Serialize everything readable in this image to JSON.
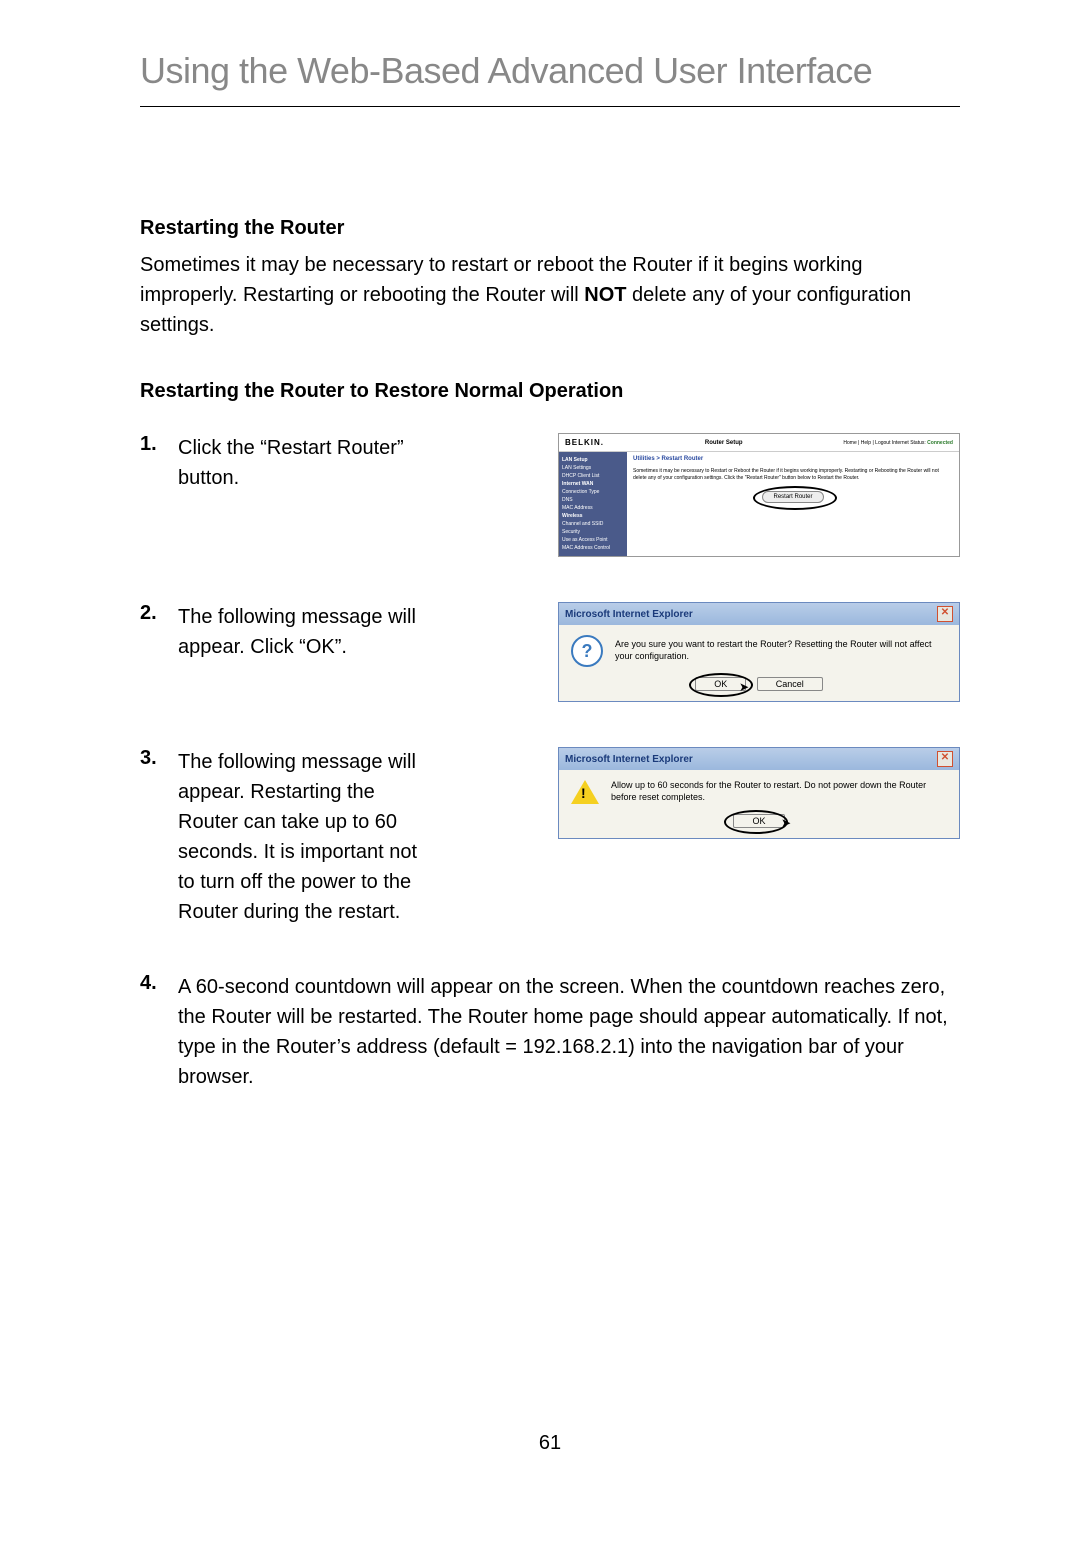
{
  "page": {
    "title": "Using the Web-Based Advanced User Interface",
    "number": "61"
  },
  "section1": {
    "heading": "Restarting the Router",
    "p1a": "Sometimes it may be necessary to restart or reboot the Router if it begins working improperly. Restarting or rebooting the Router will ",
    "p1b": "NOT",
    "p1c": " delete any of your configuration settings."
  },
  "section2": {
    "heading": "Restarting the Router to Restore Normal Operation"
  },
  "steps": [
    {
      "num": "1.",
      "text": "Click the “Restart Router” button."
    },
    {
      "num": "2.",
      "text": "The following message will appear. Click “OK”."
    },
    {
      "num": "3.",
      "text": "The following message will appear. Restarting the Router can take up to 60 seconds. It is important not to turn off the power to the Router during the restart."
    },
    {
      "num": "4.",
      "text": "A 60-second countdown will appear on the screen. When the countdown reaches zero, the Router will be restarted. The Router home page should appear automatically. If not, type in the Router’s address (default = 192.168.2.1) into the navigation bar of your browser."
    }
  ],
  "router_ui": {
    "logo": "BELKIN.",
    "header_title": "Router Setup",
    "links_label": "Home | Help | Logout   Internet Status: ",
    "links_status": "Connected",
    "sidebar": {
      "items": [
        "LAN Setup",
        "LAN Settings",
        "DHCP Client List",
        "Internet WAN",
        "Connection Type",
        "DNS",
        "MAC Address",
        "Wireless",
        "Channel and SSID",
        "Security",
        "Use as Access Point",
        "MAC Address Control"
      ]
    },
    "breadcrumb": "Utilities > Restart Router",
    "desc": "Sometimes it may be necessary to Restart or Reboot the Router if it begins working improperly. Restarting or Rebooting the Router will not delete any of your configuration settings. Click the \"Restart Router\" button below to Restart the Router.",
    "button": "Restart Router"
  },
  "dialog1": {
    "title": "Microsoft Internet Explorer",
    "message": "Are you sure you want to restart the Router? Resetting the Router will not affect your configuration.",
    "ok": "OK",
    "cancel": "Cancel"
  },
  "dialog2": {
    "title": "Microsoft Internet Explorer",
    "message": "Allow up to 60 seconds for the Router to restart. Do not power down the Router before reset completes.",
    "ok": "OK"
  }
}
